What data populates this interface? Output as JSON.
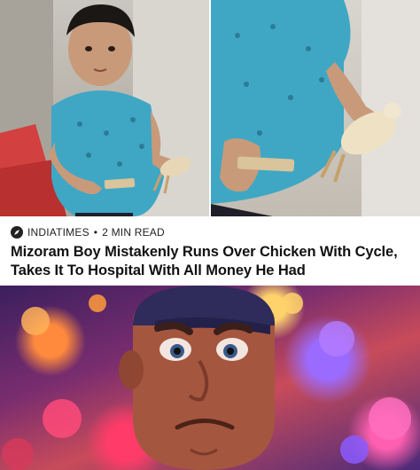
{
  "article": {
    "source": "INDIATIMES",
    "separator": "•",
    "read_time": "2 MIN READ",
    "headline": "Mizoram Boy Mistakenly Runs Over Chicken With Cycle, Takes It To Hospital With All Money He Had"
  },
  "icons": {
    "source": "compass-icon"
  }
}
